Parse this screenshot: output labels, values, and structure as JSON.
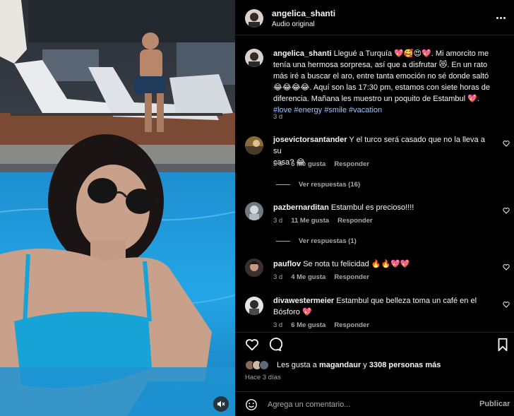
{
  "header": {
    "username": "angelica_shanti",
    "subtitle": "Audio original"
  },
  "caption": {
    "username": "angelica_shanti",
    "line1": "Llegué a Turquía 💖🥰😍💖. Mi amorcito me",
    "line2": "tenía una hermosa sorpresa, así que a disfrutar 😻. En un rato",
    "line3": "más iré a buscar el aro, entre tanta emoción no sé donde saltó",
    "line4": "😂😂😂😂. Aquí son las 17:30 pm, estamos con siete horas de",
    "line5": "diferencia. Mañana les muestro un poquito de Estambul 💖.",
    "hashtags": [
      "#love",
      "#energy",
      "#smile",
      "#vacation"
    ],
    "time": "3 d"
  },
  "comments": [
    {
      "username": "josevictorsantander",
      "text_line1": "Y el turco será casado que no la lleva a su",
      "text_line2": "casa? 😂",
      "time": "3 d",
      "likes": "5 Me gusta",
      "reply": "Responder",
      "view_replies": "Ver respuestas (16)"
    },
    {
      "username": "pazbernarditan",
      "text_line1": "Estambul es precioso!!!!",
      "time": "3 d",
      "likes": "11 Me gusta",
      "reply": "Responder",
      "view_replies": "Ver respuestas (1)"
    },
    {
      "username": "pauflov",
      "text_line1": "Se nota tu felicidad 🔥🔥💖💖",
      "time": "3 d",
      "likes": "4 Me gusta",
      "reply": "Responder"
    },
    {
      "username": "divawestermeier",
      "text_line1": "Estambul que belleza toma un café en el",
      "text_line2": "Bósforo 💖",
      "time": "3 d",
      "likes": "6 Me gusta",
      "reply": "Responder"
    }
  ],
  "likes": {
    "prefix": "Les gusta a ",
    "user": "magandaur",
    "middle": " y ",
    "count": "3308 personas más"
  },
  "date": "Hace 3 días",
  "composer": {
    "placeholder": "Agrega un comentario...",
    "publish_label": "Publicar"
  },
  "colors": {
    "background": "#000000",
    "text": "#f5f5f5",
    "secondary": "#a8a8a8",
    "hashtag": "#9ec5ff",
    "divider": "#262626"
  }
}
